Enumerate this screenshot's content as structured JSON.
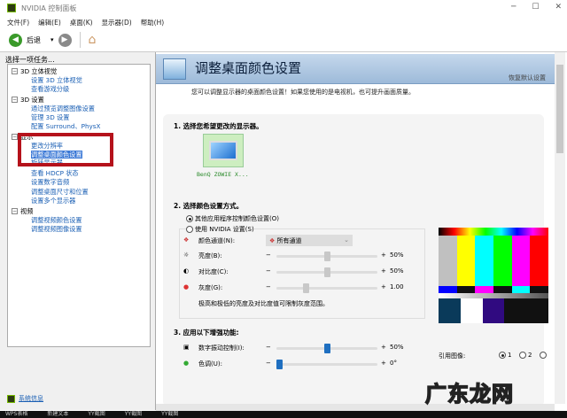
{
  "window": {
    "title": "NVIDIA 控制面板"
  },
  "menu": [
    "文件(F)",
    "编辑(E)",
    "桌面(K)",
    "显示器(D)",
    "帮助(H)"
  ],
  "toolbar": {
    "back_label": "后退"
  },
  "sidebar": {
    "heading": "选择一项任务...",
    "categories": [
      {
        "label": "3D 立体视觉",
        "items": [
          "设置 3D 立体视觉",
          "查看游戏分级"
        ]
      },
      {
        "label": "3D 设置",
        "items": [
          "通过预览调整图像设置",
          "管理 3D 设置",
          "配置 Surround、PhysX"
        ]
      },
      {
        "label": "显示",
        "items": [
          "更改分辨率",
          "调整桌面颜色设置",
          "旋转显示器",
          "查看 HDCP 状态",
          "设置数字音频",
          "调整桌面尺寸和位置",
          "设置多个显示器"
        ]
      },
      {
        "label": "视频",
        "items": [
          "调整视频颜色设置",
          "调整视频图像设置"
        ]
      }
    ],
    "selected": "调整桌面颜色设置",
    "system_info": "系统信息"
  },
  "main": {
    "title": "调整桌面颜色设置",
    "restore_defaults": "恢复默认设置",
    "description": "您可以调整显示器的桌面颜色设置！如果您使用的是电视机，也可提升画面质量。",
    "step1": {
      "label": "1.  选择您希望更改的显示器。",
      "display_name": "BenQ ZOWIE X..."
    },
    "step2": {
      "label": "2.  选择颜色设置方式。",
      "option_other": "其他应用程序控制颜色设置(O)",
      "option_nvidia": "使用 NVIDIA 设置(S)",
      "selected_option": "other",
      "channel_label": "颜色通道(N):",
      "channel_value": "所有通道",
      "brightness": {
        "label": "亮度(B):",
        "value": "50%",
        "fraction": 0.5
      },
      "contrast": {
        "label": "对比度(C):",
        "value": "50%",
        "fraction": 0.5
      },
      "gamma": {
        "label": "灰度(G):",
        "value": "1.00",
        "fraction": 0.28
      },
      "note": "极高和极低的亮度及对比度值可限制灰度范围。"
    },
    "step3": {
      "label": "3.  应用以下增强功能:",
      "vibrance": {
        "label": "数字振动控制(I):",
        "value": "50%",
        "fraction": 0.5
      },
      "hue": {
        "label": "色调(U):",
        "value": "0°",
        "fraction": 0.0
      }
    },
    "reference": {
      "label": "引用图像:",
      "options": [
        "1",
        "2",
        ""
      ],
      "selected": "1"
    },
    "minus": "−",
    "plus": "+"
  },
  "taskbar": [
    "WPS表格",
    "新建文本",
    "YY截图",
    "YY截图",
    "YY截图"
  ],
  "watermark": "广东龙网",
  "colors": {
    "header": "#9dbad9",
    "link": "#1a5fb4",
    "highlight": "#b5121b",
    "slider_active": "#1f6fc0"
  }
}
